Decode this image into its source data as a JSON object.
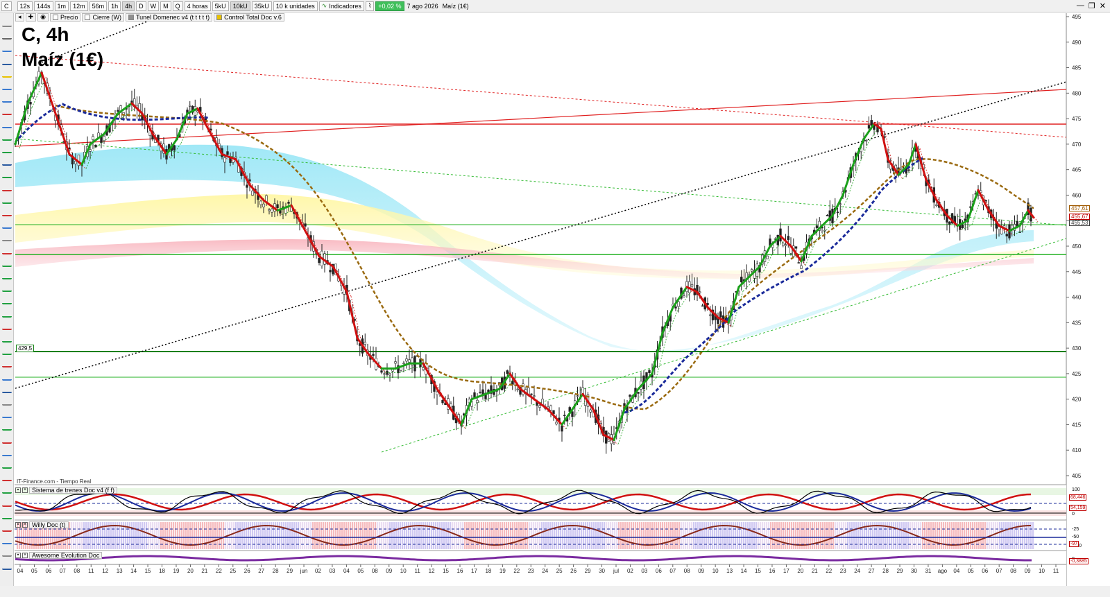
{
  "toolbar": {
    "symbol": "C",
    "timeframes": [
      "12s",
      "144s",
      "1m",
      "12m",
      "56m",
      "1h",
      "4h",
      "D",
      "W",
      "M",
      "Q"
    ],
    "active_timeframe": "4h",
    "period_select": "4 horas",
    "volume_buttons": [
      "5kU",
      "10kU",
      "35kU"
    ],
    "active_volume": "10kU",
    "units_select": "10 k unidades",
    "indicators_label": "Indicadores",
    "change_badge": "+0,02 %",
    "date_label": "7 ago 2026",
    "instrument_label": "Maíz (1€)"
  },
  "legend": {
    "items": [
      {
        "label": "Precio",
        "color": "#ffffff"
      },
      {
        "label": "Cierre (W)",
        "color": "#ffffff"
      },
      {
        "label": "Tunel Domenec v4 (t t t t t)",
        "color": "#909090"
      },
      {
        "label": "Control Total Doc v.6",
        "color": "#e8c200"
      }
    ]
  },
  "title": {
    "line1": "C, 4h",
    "line2": "Maíz (1€)"
  },
  "source": "IT-Finance.com - Tiempo Real",
  "horizontal_level_label": "429,5",
  "price_axis": {
    "ticks": [
      "495",
      "490",
      "485",
      "480",
      "475",
      "470",
      "465",
      "460",
      "455",
      "450",
      "445",
      "440",
      "435",
      "430",
      "425",
      "420",
      "415",
      "410",
      "405"
    ],
    "tags": [
      {
        "value": "457,61",
        "color": "#a05a00"
      },
      {
        "value": "455,67",
        "color": "#c00000"
      },
      {
        "value": "455,53",
        "color": "#404040"
      }
    ]
  },
  "time_axis": {
    "labels": [
      "04",
      "05",
      "06",
      "07",
      "08",
      "11",
      "12",
      "13",
      "14",
      "15",
      "18",
      "19",
      "20",
      "21",
      "22",
      "25",
      "26",
      "27",
      "28",
      "29",
      "jun",
      "02",
      "03",
      "04",
      "05",
      "08",
      "09",
      "10",
      "11",
      "12",
      "15",
      "16",
      "17",
      "18",
      "19",
      "22",
      "23",
      "24",
      "25",
      "26",
      "29",
      "30",
      "jul",
      "02",
      "03",
      "06",
      "07",
      "08",
      "09",
      "10",
      "13",
      "14",
      "15",
      "16",
      "17",
      "20",
      "21",
      "22",
      "23",
      "24",
      "27",
      "28",
      "29",
      "30",
      "31",
      "ago",
      "04",
      "05",
      "06",
      "07",
      "08",
      "09",
      "10",
      "11"
    ]
  },
  "indicators": [
    {
      "name": "Sistema de trenes Doc v4 (f f)",
      "axis": [
        "100",
        "50",
        "0"
      ],
      "tags": [
        "68,446",
        "54,159"
      ]
    },
    {
      "name": "Willy Doc (t)",
      "axis": [
        "-25",
        "-50",
        "-100"
      ],
      "tags": [
        "-97"
      ]
    },
    {
      "name": "Awesome Evolution Doc",
      "axis": [
        "0"
      ],
      "tags": [
        "-0,3885"
      ]
    }
  ],
  "colors": {
    "up_line": "#1aa01a",
    "down_line": "#d01010",
    "blue_dashed": "#1a2a9a",
    "brown_dashed": "#9a6a10",
    "cyan_band": "#7fdcf0",
    "yellow_band": "#fff08a",
    "pink_band": "#f8b0b8"
  }
}
